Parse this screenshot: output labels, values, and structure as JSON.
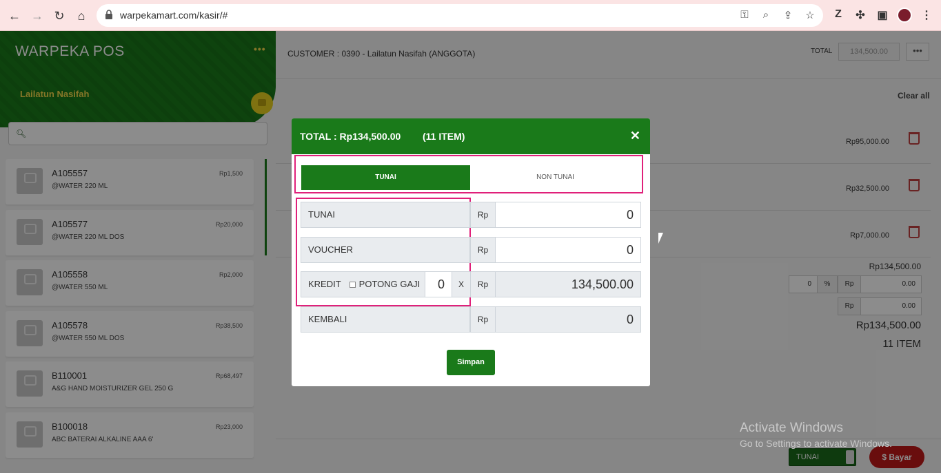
{
  "browser": {
    "url": "warpekamart.com/kasir/#"
  },
  "sidebar": {
    "brand": "WARPEKA POS",
    "menu_icon": "•••",
    "user_name": "Lailatun Nasifah",
    "search_placeholder": "",
    "products": [
      {
        "code": "A105557",
        "name": "@WATER 220 ML",
        "price": "Rp1,500"
      },
      {
        "code": "A105577",
        "name": "@WATER 220 ML DOS",
        "price": "Rp20,000"
      },
      {
        "code": "A105558",
        "name": "@WATER 550 ML",
        "price": "Rp2,000"
      },
      {
        "code": "A105578",
        "name": "@WATER 550 ML DOS",
        "price": "Rp38,500"
      },
      {
        "code": "B110001",
        "name": "A&G HAND MOISTURIZER GEL 250 G",
        "price": "Rp68,497"
      },
      {
        "code": "B100018",
        "name": "ABC BATERAI ALKALINE AAA 6'",
        "price": "Rp23,000"
      }
    ]
  },
  "main": {
    "customer": "CUSTOMER : 0390 - Lailatun Nasifah (ANGGOTA)",
    "total_label": "TOTAL",
    "total_value": "134,500.00",
    "more": "•••",
    "clear_all": "Clear all",
    "cart_amounts": [
      "Rp95,000.00",
      "Rp32,500.00",
      "Rp7,000.00"
    ],
    "subtotal": "Rp134,500.00",
    "discount_pct": "0",
    "pct_sign": "%",
    "rp": "Rp",
    "discount_value": "0.00",
    "extra_value": "0.00",
    "grand_total": "Rp134,500.00",
    "item_count": "11 ITEM",
    "pay_type": "TUNAI",
    "pay_button": "$ Bayar"
  },
  "watermark": {
    "line1": "Activate Windows",
    "line2": "Go to Settings to activate Windows."
  },
  "modal": {
    "title": "TOTAL : Rp134,500.00",
    "items": "(11 ITEM)",
    "close": "✕",
    "tabs": {
      "tunai": "TUNAI",
      "non_tunai": "NON TUNAI"
    },
    "rows": {
      "tunai": {
        "label": "TUNAI",
        "rp": "Rp",
        "value": "0"
      },
      "voucher": {
        "label": "VOUCHER",
        "rp": "Rp",
        "value": "0"
      },
      "kredit": {
        "label": "KREDIT",
        "potong": "POTONG GAJI",
        "qty": "0",
        "x": "X",
        "rp": "Rp",
        "value": "134,500.00"
      },
      "kembali": {
        "label": "KEMBALI",
        "rp": "Rp",
        "value": "0"
      }
    },
    "save": "Simpan"
  },
  "colors": {
    "brand_green": "#1a7a1a",
    "accent_yellow": "#f5d84a",
    "highlight": "#e0207a",
    "pay_red": "#c01818"
  }
}
